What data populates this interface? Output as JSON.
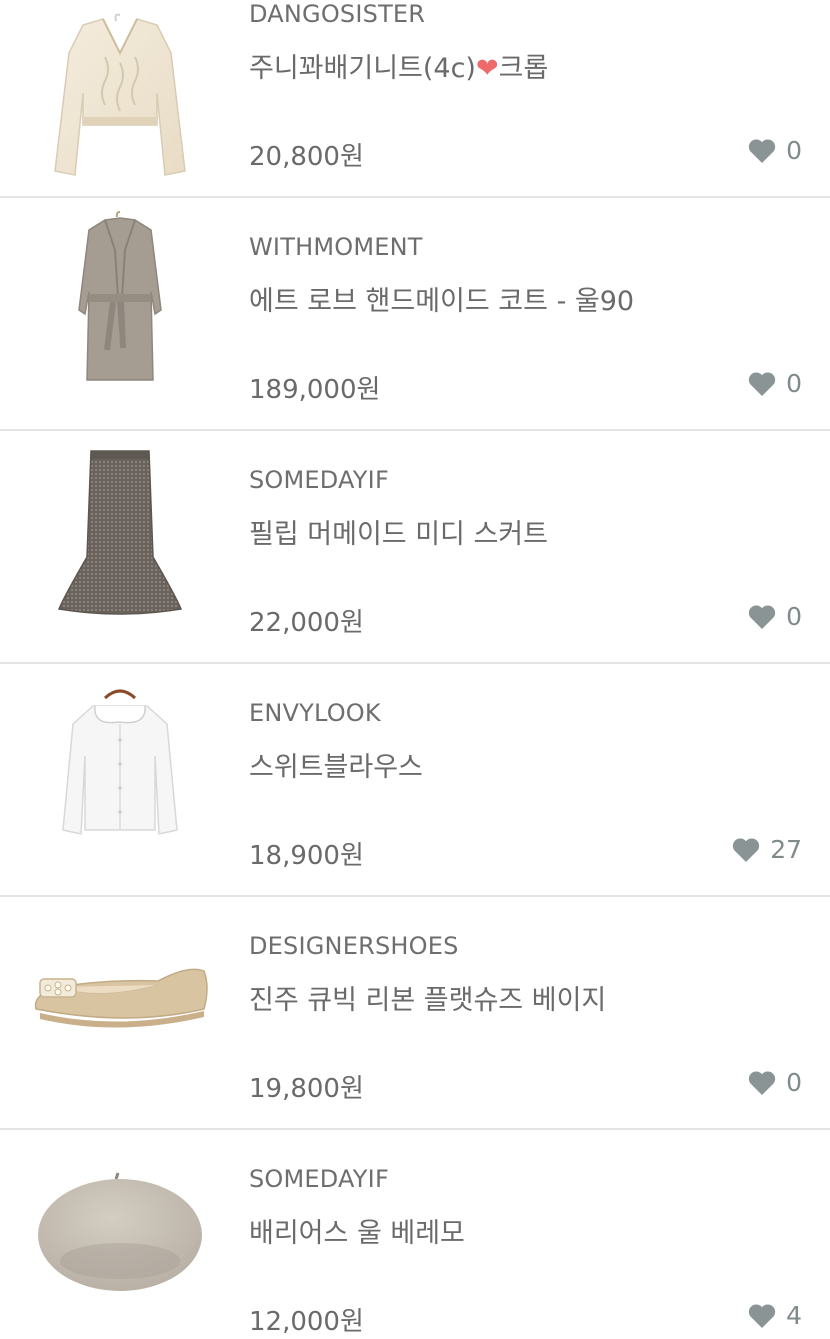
{
  "colors": {
    "heart_icon": "#8a9494",
    "inline_heart": "#ef6b6b",
    "divider": "#e4e4e4",
    "text": "#6a6a6a"
  },
  "products": [
    {
      "brand": "DANGOSISTER",
      "name_before": "주니꽈배기니트(4c)",
      "name_heart": "❤",
      "name_after": "크롭",
      "price": "20,800원",
      "likes": "0",
      "image": "cream-knit-sweater"
    },
    {
      "brand": "WITHMOMENT",
      "name_before": "에트 로브 핸드메이드 코트 - 울90",
      "name_heart": "",
      "name_after": "",
      "price": "189,000원",
      "likes": "0",
      "image": "gray-wool-coat"
    },
    {
      "brand": "SOMEDAYIF",
      "name_before": "필립 머메이드 미디 스커트",
      "name_heart": "",
      "name_after": "",
      "price": "22,000원",
      "likes": "0",
      "image": "houndstooth-mermaid-skirt"
    },
    {
      "brand": "ENVYLOOK",
      "name_before": "스위트블라우스",
      "name_heart": "",
      "name_after": "",
      "price": "18,900원",
      "likes": "27",
      "image": "white-collar-blouse"
    },
    {
      "brand": "DESIGNERSHOES",
      "name_before": "진주 큐빅 리본 플랫슈즈 베이지",
      "name_heart": "",
      "name_after": "",
      "price": "19,800원",
      "likes": "0",
      "image": "beige-flat-shoe"
    },
    {
      "brand": "SOMEDAYIF",
      "name_before": "배리어스 울 베레모",
      "name_heart": "",
      "name_after": "",
      "price": "12,000원",
      "likes": "4",
      "image": "wool-beret"
    }
  ]
}
